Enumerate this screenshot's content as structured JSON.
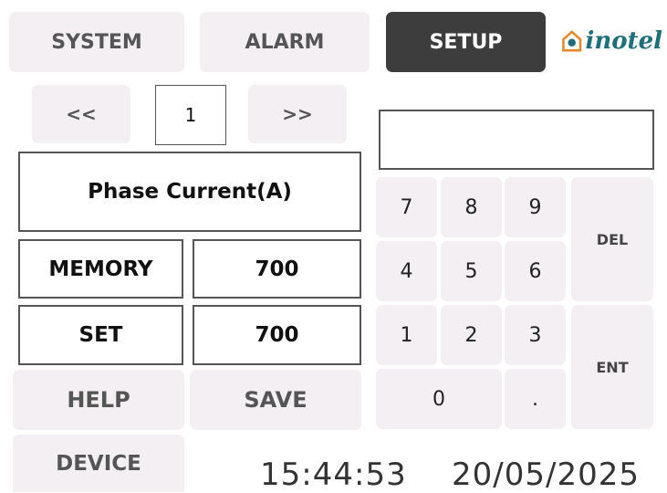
{
  "tabs": {
    "system": "SYSTEM",
    "alarm": "ALARM",
    "setup": "SETUP"
  },
  "logo": {
    "text": "inotel"
  },
  "pager": {
    "prev": "<<",
    "page": "1",
    "next": ">>"
  },
  "parameter": {
    "title": "Phase Current(A)"
  },
  "memory": {
    "label": "MEMORY",
    "value": "700"
  },
  "set": {
    "label": "SET",
    "value": "700"
  },
  "actions": {
    "help": "HELP",
    "save": "SAVE",
    "device": "DEVICE"
  },
  "keypad": {
    "display": "",
    "k7": "7",
    "k8": "8",
    "k9": "9",
    "k4": "4",
    "k5": "5",
    "k6": "6",
    "k1": "1",
    "k2": "2",
    "k3": "3",
    "k0": "0",
    "dot": ".",
    "del": "DEL",
    "ent": "ENT"
  },
  "status": {
    "time": "15:44:53",
    "date": "20/05/2025"
  },
  "colors": {
    "active_tab": "#3d3d3d",
    "button_bg": "#f4eff3",
    "logo_orange": "#e08a2a",
    "logo_teal": "#1f6f7a"
  }
}
